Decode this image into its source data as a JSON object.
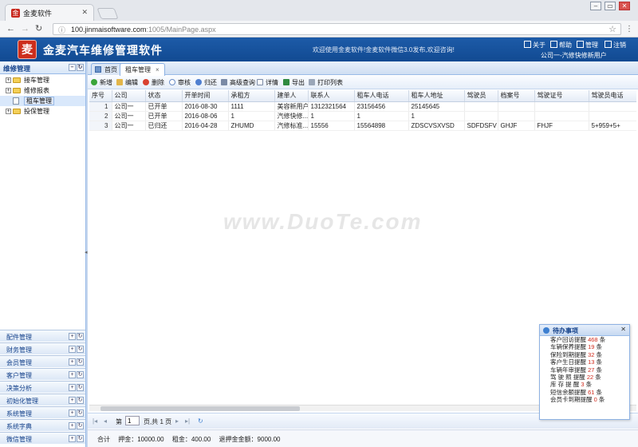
{
  "browser": {
    "tab_title": "金麦软件",
    "url_host": "100.jinmaisoftware.com",
    "url_rest": ":1005/MainPage.aspx"
  },
  "header": {
    "logo_char": "麦",
    "title": "金麦汽车维修管理软件",
    "welcome": "欢迎使用金麦软件!金麦软件微信3.0发布,欢迎咨询!",
    "links": [
      "关于",
      "帮助",
      "管理",
      "注销"
    ],
    "company": "公司一-汽修快修新用户"
  },
  "sidebar": {
    "title": "维修管理",
    "tree": [
      {
        "label": "接车管理",
        "type": "folder"
      },
      {
        "label": "维修报表",
        "type": "folder"
      },
      {
        "label": "租车管理",
        "type": "doc",
        "selected": true
      },
      {
        "label": "投保管理",
        "type": "folder"
      }
    ],
    "sections": [
      "配件管理",
      "财务管理",
      "会员管理",
      "客户管理",
      "决策分析",
      "初始化管理",
      "系统管理",
      "系统字典",
      "微信管理"
    ]
  },
  "tabs": [
    "首页",
    "租车管理"
  ],
  "toolbar": [
    "新增",
    "编辑",
    "删除",
    "审核",
    "归还",
    "高级查询",
    "详情",
    "导出",
    "打印列表"
  ],
  "grid": {
    "columns": [
      "序号",
      "公司",
      "状态",
      "开单时间",
      "承租方",
      "建单人",
      "联系人",
      "租车人电话",
      "租车人地址",
      "驾驶员",
      "档案号",
      "驾驶证号",
      "驾驶员电话"
    ],
    "rows": [
      [
        "1",
        "公司一",
        "已开单",
        "2016-08-30",
        "1111",
        "美容新用户",
        "1312321564",
        "23156456",
        "25145645",
        "",
        "",
        "",
        ""
      ],
      [
        "2",
        "公司一",
        "已开单",
        "2016-08-06",
        "1",
        "汽修快修...",
        "1",
        "1",
        "1",
        "",
        "",
        "",
        ""
      ],
      [
        "3",
        "公司一",
        "已归还",
        "2016-04-28",
        "ZHUMD",
        "汽修标准...",
        "15556",
        "15564898",
        "ZDSCVSXVSD",
        "SDFDSFV",
        "GHJF",
        "FHJF",
        "5+959+5+"
      ]
    ]
  },
  "pager": {
    "page_label": "第",
    "page_value": "1",
    "page_total": "页,共 1 页"
  },
  "summary": [
    "合计",
    "押金：10000.00",
    "租金：400.00",
    "退押金金额：9000.00"
  ],
  "todo": {
    "title": "待办事项",
    "items": [
      {
        "label": "客户回访提醒",
        "count": "468",
        "unit": "条"
      },
      {
        "label": "车辆保养提醒",
        "count": "19",
        "unit": "条"
      },
      {
        "label": "保险到期提醒",
        "count": "32",
        "unit": "条"
      },
      {
        "label": "客户生日提醒",
        "count": "13",
        "unit": "条"
      },
      {
        "label": "车辆年审提醒",
        "count": "27",
        "unit": "条"
      },
      {
        "label": "驾 驶 照 提醒",
        "count": "22",
        "unit": "条"
      },
      {
        "label": "库 存 提 醒",
        "count": "3",
        "unit": "条"
      },
      {
        "label": "短信余额提醒",
        "count": "61",
        "unit": "条"
      },
      {
        "label": "会员卡到期提醒",
        "count": "0",
        "unit": "条"
      }
    ]
  },
  "watermark": "www.DuoTe.com"
}
